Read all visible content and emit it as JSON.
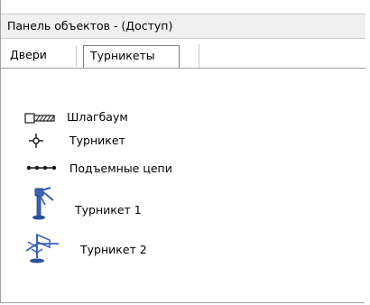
{
  "window": {
    "title": "Панель объектов - (Доступ)"
  },
  "tabs": [
    {
      "label": "Двери",
      "active": false
    },
    {
      "label": "Турникеты",
      "active": true
    }
  ],
  "objects": [
    {
      "label": "Шлагбаум",
      "icon": "barrier-icon"
    },
    {
      "label": "Турникет",
      "icon": "turnstile-symbol-icon"
    },
    {
      "label": "Подъемные цепи",
      "icon": "lifting-chains-icon"
    },
    {
      "label": "Турникет 1",
      "icon": "turnstile-tripod-icon"
    },
    {
      "label": "Турникет 2",
      "icon": "turnstile-tripod-gate-icon"
    }
  ],
  "colors": {
    "icon_blue": "#3a63b8",
    "icon_dark": "#1a1a1a"
  }
}
